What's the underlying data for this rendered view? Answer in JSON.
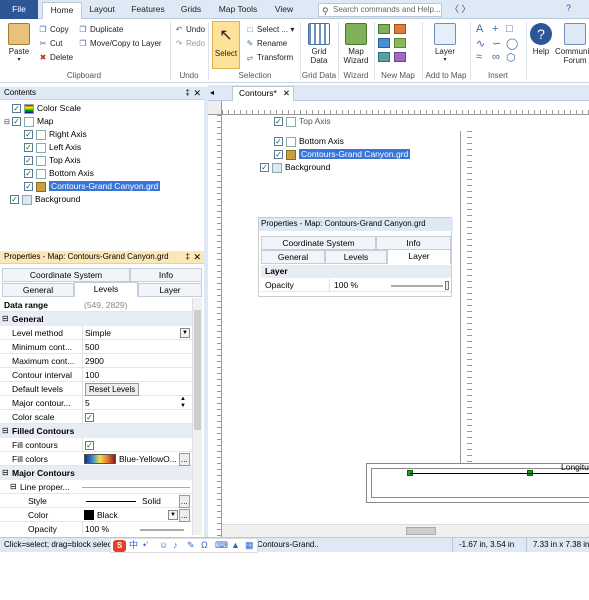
{
  "ribbon": {
    "tabs": [
      "File",
      "Home",
      "Layout",
      "Features",
      "Grids",
      "Map Tools",
      "View"
    ],
    "search_placeholder": "Search commands and Help...",
    "clipboard": {
      "paste": "Paste",
      "copy": "Copy",
      "cut": "Cut",
      "delete": "Delete",
      "duplicate": "Duplicate",
      "move_copy": "Move/Copy to Layer",
      "label": "Clipboard"
    },
    "undo": {
      "undo": "Undo",
      "redo": "Redo",
      "label": "Undo"
    },
    "selection": {
      "select": "Select",
      "select_all": "Select ...",
      "rename": "Rename",
      "transform": "Transform",
      "label": "Selection"
    },
    "grid_data": {
      "button": "Grid Data",
      "label": "Grid Data"
    },
    "wizard": {
      "button": "Map Wizard",
      "label": "Wizard"
    },
    "new_map": {
      "label": "New Map"
    },
    "add_to_map": {
      "button": "Layer",
      "label": "Add to Map"
    },
    "insert": {
      "label": "Insert"
    },
    "help": {
      "help": "Help",
      "community": "Community Forum"
    }
  },
  "contents": {
    "title": "Contents",
    "items": [
      {
        "label": "Color Scale"
      },
      {
        "label": "Map"
      },
      {
        "label": "Right Axis"
      },
      {
        "label": "Left Axis"
      },
      {
        "label": "Top Axis"
      },
      {
        "label": "Bottom Axis"
      },
      {
        "label": "Contours-Grand Canyon.grd"
      },
      {
        "label": "Background"
      }
    ]
  },
  "properties": {
    "title": "Properties - Map: Contours-Grand Canyon.grd",
    "tabs_top": [
      "Coordinate System",
      "Info"
    ],
    "tabs_bottom": [
      "General",
      "Levels",
      "Layer"
    ],
    "data_range_label": "Data range",
    "data_range_value": "(549, 2829)",
    "general": {
      "cat": "General",
      "level_method": "Level method",
      "level_method_val": "Simple",
      "min": "Minimum cont...",
      "min_val": "500",
      "max": "Maximum cont...",
      "max_val": "2900",
      "interval": "Contour interval",
      "interval_val": "100",
      "default": "Default levels",
      "default_btn": "Reset Levels",
      "major": "Major contour...",
      "major_val": "5",
      "color_scale": "Color scale"
    },
    "filled": {
      "cat": "Filled Contours",
      "fill": "Fill contours",
      "fill_colors": "Fill colors",
      "fill_colors_val": "Blue-YellowO..."
    },
    "major_contours": {
      "cat": "Major Contours",
      "line_props": "Line proper...",
      "style": "Style",
      "style_val": "Solid",
      "color": "Color",
      "color_val": "Black",
      "opacity": "Opacity",
      "opacity_val": "100 %"
    }
  },
  "doc": {
    "tab": "Contours*",
    "float_tree": [
      "Top Axis",
      "Bottom Axis",
      "Contours-Grand Canyon.grd",
      "Background"
    ],
    "float_props": {
      "title": "Properties - Map: Contours-Grand Canyon.grd",
      "tabs_top": [
        "Coordinate System",
        "Info"
      ],
      "tabs_bottom": [
        "General",
        "Levels",
        "Layer"
      ],
      "cat": "Layer",
      "opacity": "Opacity",
      "opacity_val": "100 %"
    },
    "axis_label": "Longitu"
  },
  "status": {
    "hint": "Click=select; drag=block select",
    "doc": "Contours-Grand...",
    "coords": "-1.67 in, 3.54 in",
    "size": "7.33 in x 7.38 in"
  },
  "colors": {
    "accent": "#2b5797",
    "selection": "#3875d7",
    "panel": "#dfe9f5"
  }
}
